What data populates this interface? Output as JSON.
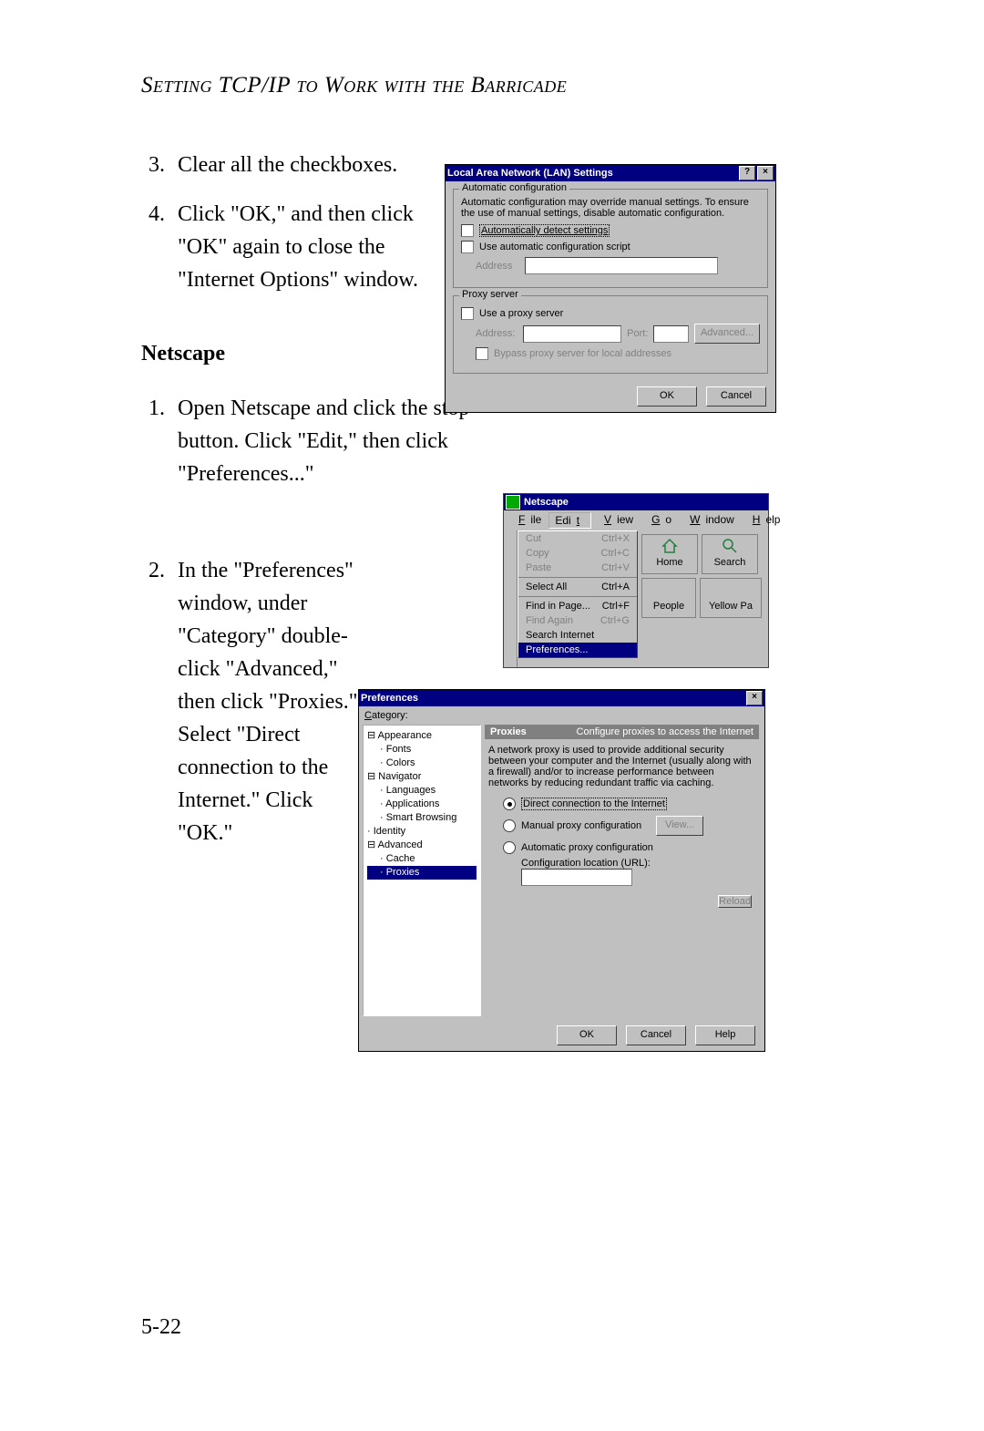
{
  "page": {
    "title": "Setting TCP/IP to Work with the Barricade",
    "page_number": "5-22",
    "steps_top": [
      {
        "n": "3.",
        "t": "Clear all the checkboxes."
      },
      {
        "n": "4.",
        "t": "Click \"OK,\" and then click \"OK\" again to close the \"Internet Options\" window."
      }
    ],
    "section": "Netscape",
    "steps_ns": [
      {
        "n": "1.",
        "t": "Open Netscape and click the stop button. Click \"Edit,\" then click \"Preferences...\""
      },
      {
        "n": "2.",
        "t": "In the \"Preferences\" window, under \"Category\" double-click \"Advanced,\" then click \"Proxies.\" Select \"Direct connection to the Internet.\" Click \"OK.\""
      }
    ]
  },
  "lan_dialog": {
    "title": "Local Area Network (LAN) Settings",
    "group1": "Automatic configuration",
    "desc": "Automatic configuration may override manual settings. To ensure the use of manual settings, disable automatic configuration.",
    "cb_auto_detect": "Automatically detect settings",
    "cb_auto_script": "Use automatic configuration script",
    "addr_label": "Address",
    "group2": "Proxy server",
    "cb_use_proxy": "Use a proxy server",
    "proxy_addr": "Address:",
    "proxy_port": "Port:",
    "btn_advanced": "Advanced...",
    "cb_bypass": "Bypass proxy server for local addresses",
    "btn_ok": "OK",
    "btn_cancel": "Cancel"
  },
  "ns_window": {
    "title": "Netscape",
    "menus": [
      "File",
      "Edit",
      "View",
      "Go",
      "Window",
      "Help"
    ],
    "edit_menu": [
      {
        "l": "Cut",
        "s": "Ctrl+X",
        "d": true
      },
      {
        "l": "Copy",
        "s": "Ctrl+C",
        "d": true
      },
      {
        "l": "Paste",
        "s": "Ctrl+V",
        "d": true
      },
      {
        "l": "Select All",
        "s": "Ctrl+A",
        "d": false
      },
      {
        "l": "Find in Page...",
        "s": "Ctrl+F",
        "d": false
      },
      {
        "l": "Find Again",
        "s": "Ctrl+G",
        "d": true
      },
      {
        "l": "Search Internet",
        "s": "",
        "d": false
      },
      {
        "l": "Preferences...",
        "s": "",
        "d": false,
        "sel": true
      }
    ],
    "right_btns": [
      "Home",
      "Search",
      "People",
      "Yellow Pa"
    ]
  },
  "prefs_dialog": {
    "title": "Preferences",
    "category_label": "Category:",
    "tree": {
      "Appearance": [
        "Fonts",
        "Colors"
      ],
      "Navigator": [
        "Languages",
        "Applications",
        "Smart Browsing"
      ],
      "Identity": [],
      "Advanced": [
        "Cache",
        "Proxies"
      ]
    },
    "selected": "Proxies",
    "panel_title": "Proxies",
    "panel_sub": "Configure proxies to access the Internet",
    "panel_desc": "A network proxy is used to provide additional security between your computer and the Internet (usually along with a firewall) and/or to increase performance between networks by reducing redundant traffic via caching.",
    "radio_direct": "Direct connection to the Internet",
    "radio_manual": "Manual proxy configuration",
    "btn_view": "View...",
    "radio_auto": "Automatic proxy configuration",
    "url_label": "Configuration location (URL):",
    "btn_reload": "Reload",
    "btn_ok": "OK",
    "btn_cancel": "Cancel",
    "btn_help": "Help"
  }
}
